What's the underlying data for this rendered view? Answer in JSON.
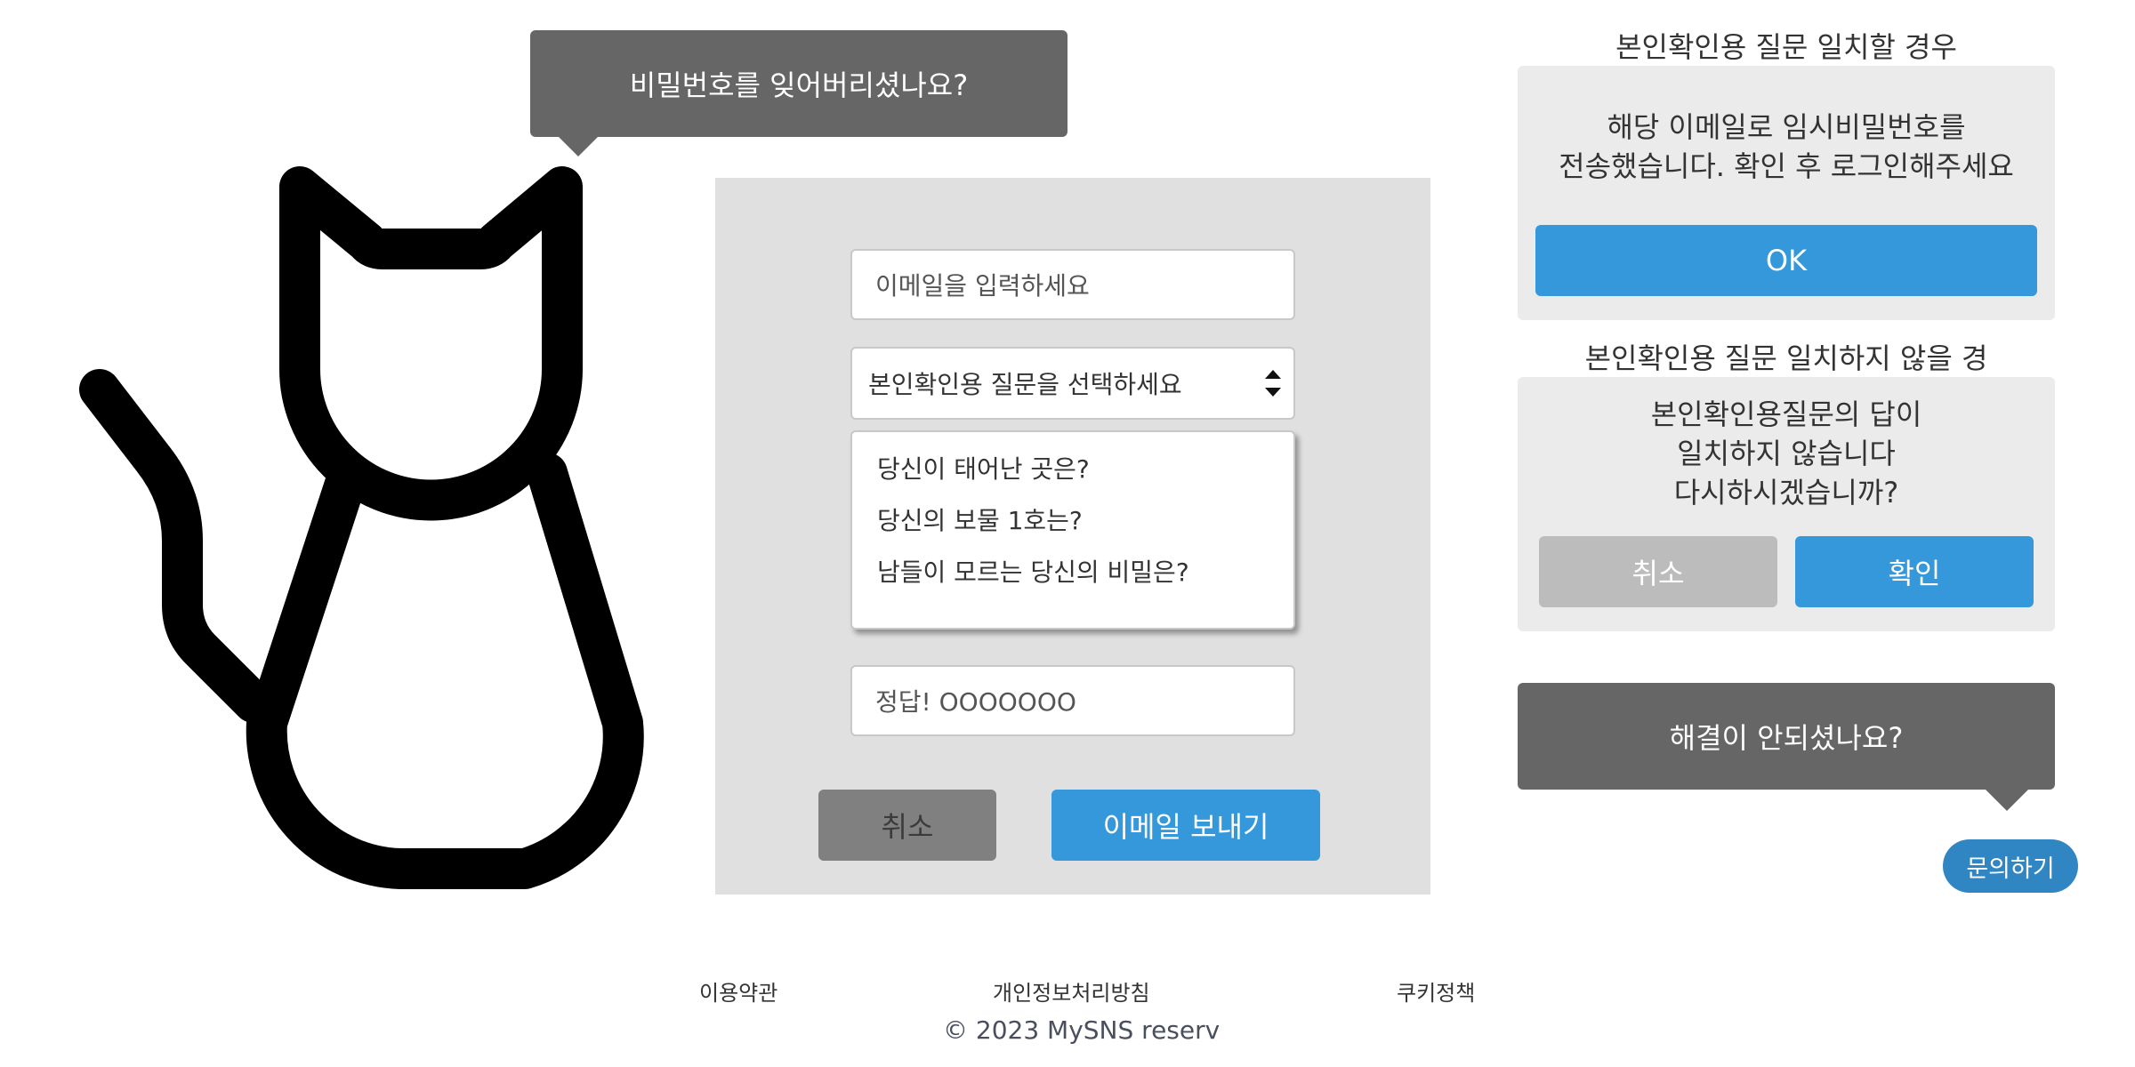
{
  "colors": {
    "bubble": "#666666",
    "panel": "#e0e0e0",
    "card": "#ebebeb",
    "accent_blue": "#3498db",
    "cancel_dark": "#808080",
    "cancel_light": "#bcbcbc",
    "pill": "#2f86c2"
  },
  "header_bubble": {
    "text": "비밀번호를 잊어버리셨나요?"
  },
  "form": {
    "email_placeholder": "이메일을 입력하세요",
    "question_select_value": "본인확인용 질문을 선택하세요",
    "question_options": [
      "당신이 태어난 곳은?",
      "당신의 보물 1호는?",
      "남들이 모르는 당신의 비밀은?"
    ],
    "answer_placeholder": "정답! OOOOOOO",
    "cancel_label": "취소",
    "send_label": "이메일 보내기"
  },
  "match_card": {
    "title": "본인확인용 질문 일치할 경우",
    "message_line1": "해당 이메일로 임시비밀번호를",
    "message_line2": "전송했습니다. 확인 후 로그인해주세요",
    "ok_label": "OK"
  },
  "mismatch_card": {
    "title": "본인확인용 질문 일치하지 않을 경",
    "message_line1": "본인확인용질문의 답이",
    "message_line2": "일치하지 않습니다",
    "message_line3": "다시하시겠습니까?",
    "cancel_label": "취소",
    "confirm_label": "확인"
  },
  "help_bubble": {
    "text": "해결이 안되셨나요?"
  },
  "contact_button": {
    "label": "문의하기"
  },
  "footer": {
    "terms": "이용약관",
    "privacy": "개인정보처리방침",
    "cookies": "쿠키정책",
    "copyright": "© 2023 MySNS reserv"
  }
}
